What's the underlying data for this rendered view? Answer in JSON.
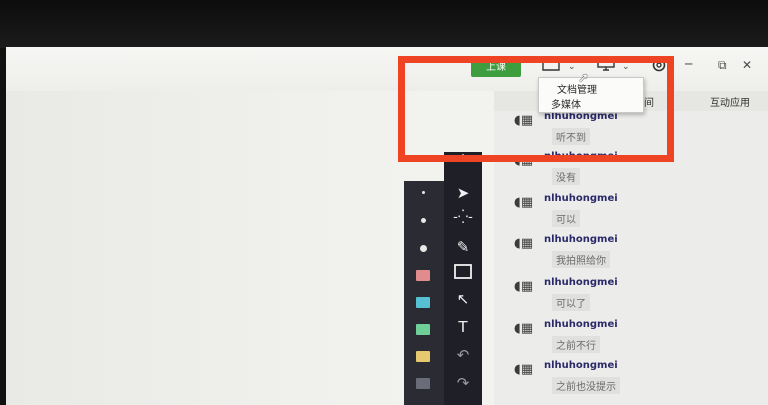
{
  "header": {
    "class_button_label": "上课",
    "window_controls": [
      "─",
      "⧉",
      "✕"
    ]
  },
  "dropdown": {
    "items": [
      "文档管理",
      "多媒体"
    ]
  },
  "sidebar": {
    "tab_partial": "间",
    "tab_interactive": "互动应用"
  },
  "chat": {
    "messages": [
      {
        "user": "nlhuhongmei",
        "text": "听不到"
      },
      {
        "user": "nlhuhongmei",
        "text": "没有"
      },
      {
        "user": "nlhuhongmei",
        "text": "可以"
      },
      {
        "user": "nlhuhongmei",
        "text": "我拍照给你"
      },
      {
        "user": "nlhuhongmei",
        "text": "可以了"
      },
      {
        "user": "nlhuhongmei",
        "text": "之前不行"
      },
      {
        "user": "nlhuhongmei",
        "text": "之前也没提示"
      }
    ]
  },
  "drawing_toolbar": {
    "tools": [
      "collapse-icon",
      "pointer-icon",
      "laser-icon",
      "pen-icon",
      "rectangle-icon",
      "arrow-icon",
      "text-icon",
      "undo-icon",
      "redo-icon"
    ],
    "colors": [
      "#e08c8c",
      "#56c1d2",
      "#6fcf97",
      "#e6c86e",
      "#6a6d79"
    ]
  },
  "highlight": {
    "color": "#ef4423"
  }
}
